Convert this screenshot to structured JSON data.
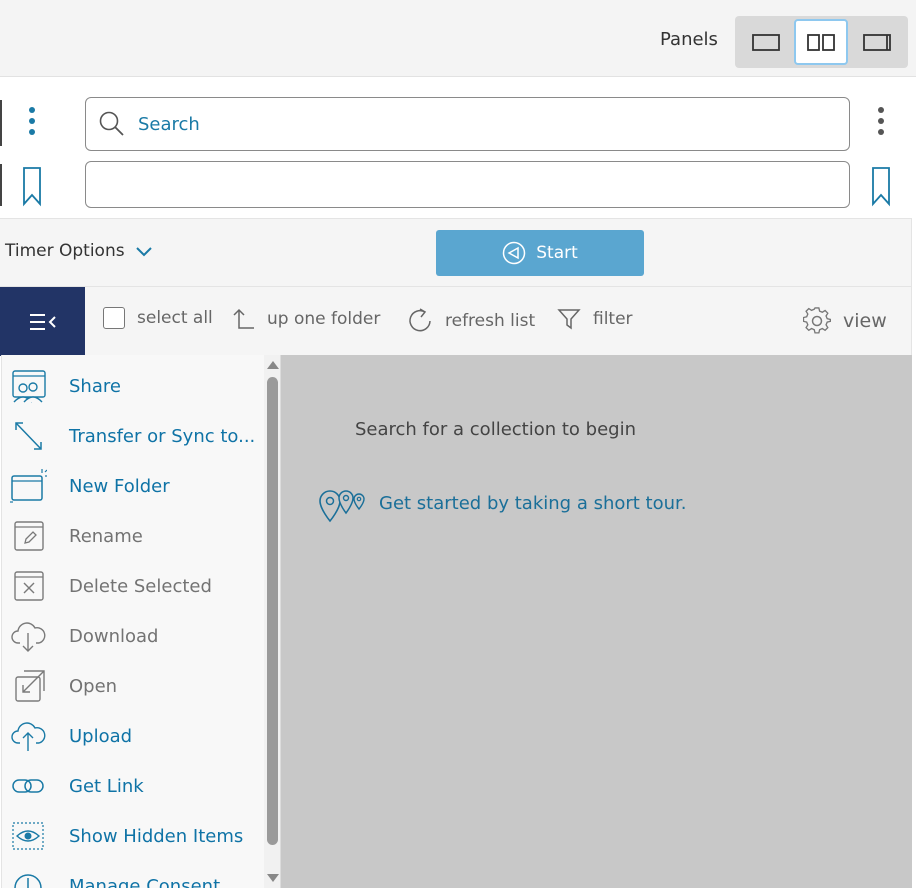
{
  "topbar": {
    "panels_label": "Panels",
    "panel_modes": [
      {
        "name": "single",
        "active": false
      },
      {
        "name": "dual",
        "active": true
      },
      {
        "name": "right",
        "active": false
      }
    ]
  },
  "search": {
    "placeholder": "Search",
    "value": ""
  },
  "path": {
    "value": ""
  },
  "timer": {
    "options_label": "Timer Options",
    "start_label": "Start"
  },
  "toolbar": {
    "select_all": "select all",
    "up_one_folder": "up one folder",
    "refresh_list": "refresh list",
    "filter": "filter",
    "view": "view"
  },
  "menu": {
    "items": [
      {
        "label": "Share",
        "icon": "share-icon",
        "enabled": true
      },
      {
        "label": "Transfer or Sync to...",
        "icon": "transfer-icon",
        "enabled": true
      },
      {
        "label": "New Folder",
        "icon": "new-folder-icon",
        "enabled": true
      },
      {
        "label": "Rename",
        "icon": "rename-icon",
        "enabled": false
      },
      {
        "label": "Delete Selected",
        "icon": "delete-icon",
        "enabled": false
      },
      {
        "label": "Download",
        "icon": "download-icon",
        "enabled": false
      },
      {
        "label": "Open",
        "icon": "open-icon",
        "enabled": false
      },
      {
        "label": "Upload",
        "icon": "upload-icon",
        "enabled": true
      },
      {
        "label": "Get Link",
        "icon": "link-icon",
        "enabled": true
      },
      {
        "label": "Show Hidden Items",
        "icon": "eye-icon",
        "enabled": true
      },
      {
        "label": "Manage Consent",
        "icon": "power-icon",
        "enabled": true
      }
    ]
  },
  "content": {
    "empty_message": "Search for a collection to begin",
    "tour_link": "Get started by taking a short tour."
  },
  "colors": {
    "accent": "#0f73a6",
    "nav_dark": "#223466",
    "start_button": "#5aa6d0",
    "content_bg": "#c8c8c8"
  }
}
